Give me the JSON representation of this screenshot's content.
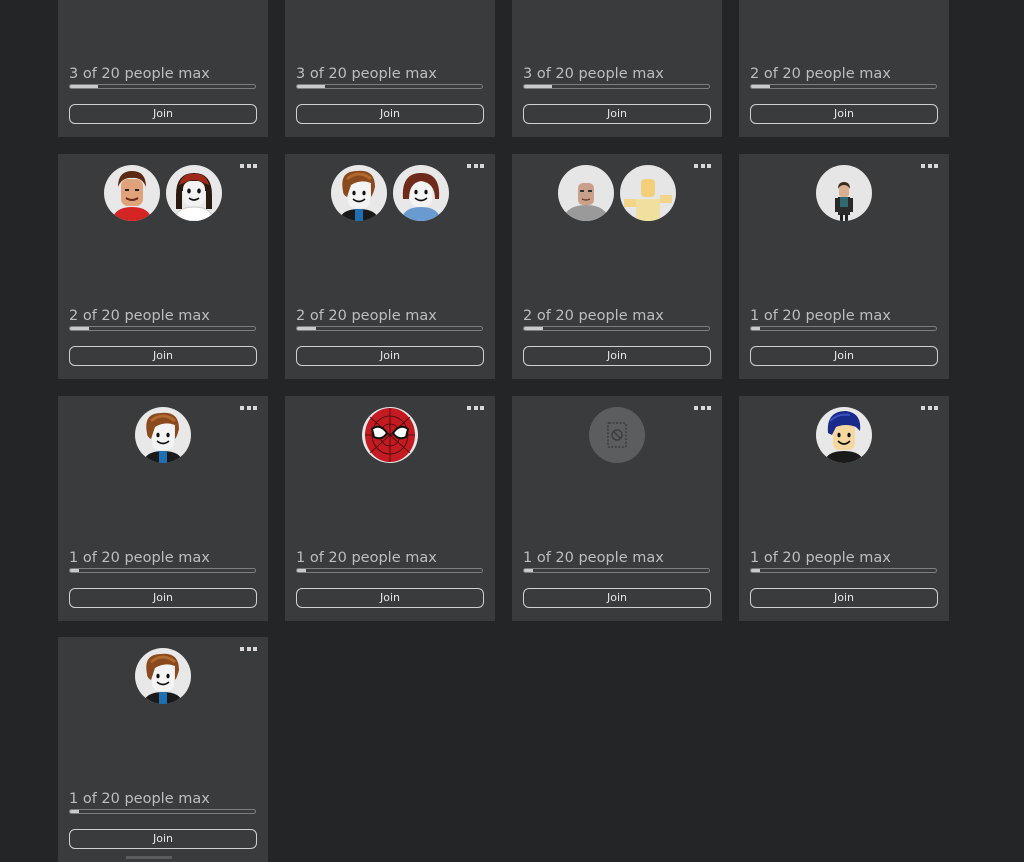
{
  "colors": {
    "page_bg": "#232527",
    "card_bg": "#393b3d",
    "text": "#bdbebe",
    "bar_fill": "#c9cacb"
  },
  "servers": [
    {
      "count_label": "3 of 20 people max",
      "occupancy": 0.15,
      "join_label": "Join",
      "avatars": []
    },
    {
      "count_label": "3 of 20 people max",
      "occupancy": 0.15,
      "join_label": "Join",
      "avatars": []
    },
    {
      "count_label": "3 of 20 people max",
      "occupancy": 0.15,
      "join_label": "Join",
      "avatars": []
    },
    {
      "count_label": "2 of 20 people max",
      "occupancy": 0.1,
      "join_label": "Join",
      "avatars": []
    },
    {
      "count_label": "2 of 20 people max",
      "occupancy": 0.1,
      "join_label": "Join",
      "avatars": [
        "avatar-brown-hair-red-shirt",
        "avatar-black-hair-white-face"
      ]
    },
    {
      "count_label": "2 of 20 people max",
      "occupancy": 0.1,
      "join_label": "Join",
      "avatars": [
        "avatar-brown-hair-bacon",
        "avatar-dark-red-hair-blue-shirt"
      ]
    },
    {
      "count_label": "2 of 20 people max",
      "occupancy": 0.1,
      "join_label": "Join",
      "avatars": [
        "avatar-bald-grey",
        "avatar-yellow-blocky"
      ]
    },
    {
      "count_label": "1 of 20 people max",
      "occupancy": 0.05,
      "join_label": "Join",
      "avatars": [
        "avatar-small-figure"
      ]
    },
    {
      "count_label": "1 of 20 people max",
      "occupancy": 0.05,
      "join_label": "Join",
      "avatars": [
        "avatar-brown-hair-bacon"
      ]
    },
    {
      "count_label": "1 of 20 people max",
      "occupancy": 0.05,
      "join_label": "Join",
      "avatars": [
        "avatar-spiderman-mask"
      ]
    },
    {
      "count_label": "1 of 20 people max",
      "occupancy": 0.05,
      "join_label": "Join",
      "avatars": [
        "avatar-unavailable-placeholder"
      ]
    },
    {
      "count_label": "1 of 20 people max",
      "occupancy": 0.05,
      "join_label": "Join",
      "avatars": [
        "avatar-blue-hair-smile"
      ]
    },
    {
      "count_label": "1 of 20 people max",
      "occupancy": 0.05,
      "join_label": "Join",
      "avatars": [
        "avatar-brown-hair-bacon"
      ]
    }
  ]
}
